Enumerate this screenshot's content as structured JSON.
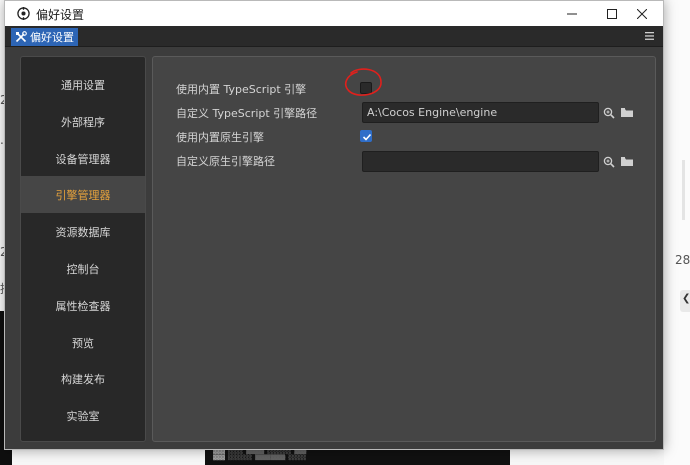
{
  "window": {
    "title": "偏好设置"
  },
  "tabbar": {
    "active_tab": "偏好设置"
  },
  "sidebar": {
    "items": [
      {
        "label": "通用设置",
        "active": false
      },
      {
        "label": "外部程序",
        "active": false
      },
      {
        "label": "设备管理器",
        "active": false
      },
      {
        "label": "引擎管理器",
        "active": true
      },
      {
        "label": "资源数据库",
        "active": false
      },
      {
        "label": "控制台",
        "active": false
      },
      {
        "label": "属性检查器",
        "active": false
      },
      {
        "label": "预览",
        "active": false
      },
      {
        "label": "构建发布",
        "active": false
      },
      {
        "label": "实验室",
        "active": false
      }
    ]
  },
  "settings": {
    "builtin_ts_label": "使用内置 TypeScript 引擎",
    "builtin_ts_checked": false,
    "custom_ts_path_label": "自定义 TypeScript 引擎路径",
    "custom_ts_path_value": "A:\\Cocos Engine\\engine",
    "builtin_native_label": "使用内置原生引擎",
    "builtin_native_checked": true,
    "custom_native_path_label": "自定义原生引擎路径",
    "custom_native_path_value": ""
  },
  "background": {
    "left_digit_1": "2",
    "left_digit_2": "2",
    "left_ellipsis": "...",
    "left_char": "描",
    "right_number": "28"
  },
  "colors": {
    "accent_blue": "#2d65b5",
    "active_menu_text": "#e6a23c",
    "annotation_red": "#e0201c"
  },
  "icons": {
    "app": "tools-icon",
    "search": "search-icon",
    "folder": "folder-icon",
    "menu": "hamburger-menu-icon"
  }
}
